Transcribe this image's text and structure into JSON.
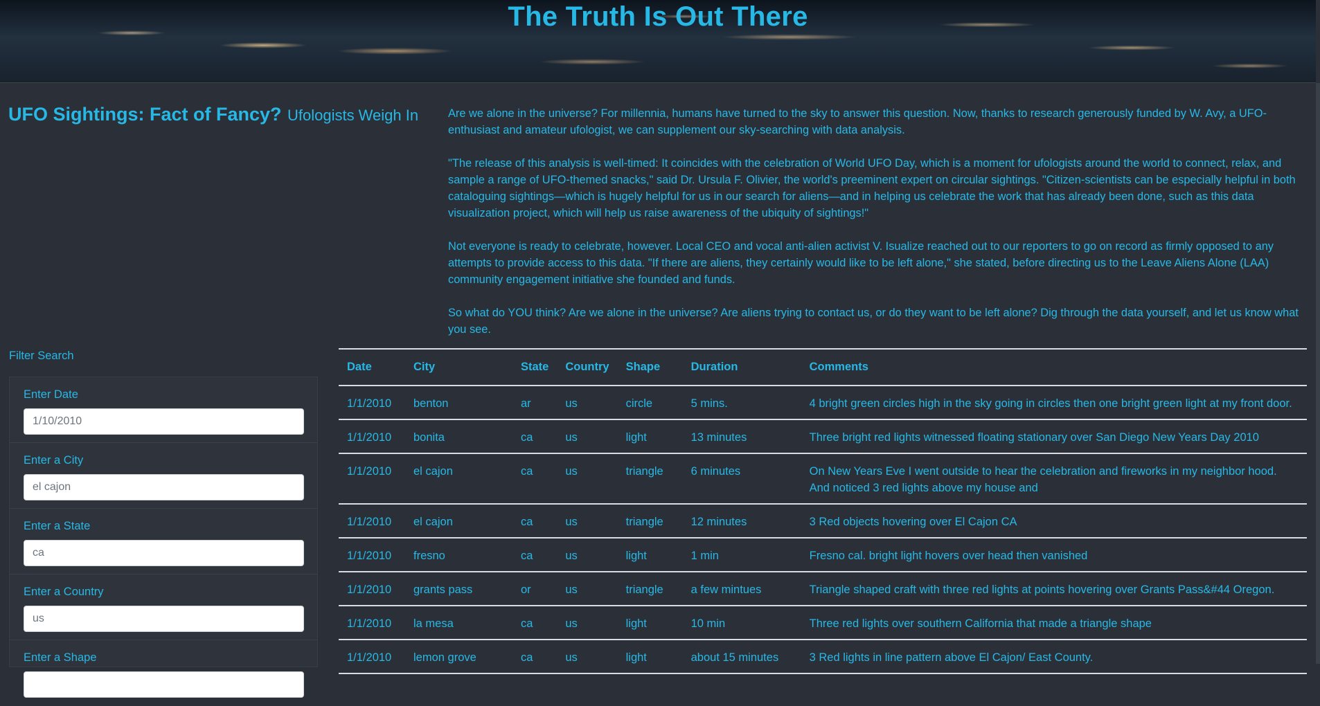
{
  "header": {
    "title": "The Truth Is Out There"
  },
  "intro": {
    "title": "UFO Sightings: Fact of Fancy?",
    "subtitle": "Ufologists Weigh In",
    "paragraphs": [
      "Are we alone in the universe? For millennia, humans have turned to the sky to answer this question. Now, thanks to research generously funded by W. Avy, a UFO-enthusiast and amateur ufologist, we can supplement our sky-searching with data analysis.",
      "\"The release of this analysis is well-timed: It coincides with the celebration of World UFO Day, which is a moment for ufologists around the world to connect, relax, and sample a range of UFO-themed snacks,\" said Dr. Ursula F. Olivier, the world's preeminent expert on circular sightings. \"Citizen-scientists can be especially helpful in both cataloguing sightings—which is hugely helpful for us in our search for aliens—and in helping us celebrate the work that has already been done, such as this data visualization project, which will help us raise awareness of the ubiquity of sightings!\"",
      "Not everyone is ready to celebrate, however. Local CEO and vocal anti-alien activist V. Isualize reached out to our reporters to go on record as firmly opposed to any attempts to provide access to this data. \"If there are aliens, they certainly would like to be left alone,\" she stated, before directing us to the Leave Aliens Alone (LAA) community engagement initiative she founded and funds.",
      "So what do YOU think? Are we alone in the universe? Are aliens trying to contact us, or do they want to be left alone? Dig through the data yourself, and let us know what you see."
    ]
  },
  "filters": {
    "heading": "Filter Search",
    "items": [
      {
        "label": "Enter Date",
        "placeholder": "1/10/2010"
      },
      {
        "label": "Enter a City",
        "placeholder": "el cajon"
      },
      {
        "label": "Enter a State",
        "placeholder": "ca"
      },
      {
        "label": "Enter a Country",
        "placeholder": "us"
      },
      {
        "label": "Enter a Shape",
        "placeholder": ""
      }
    ]
  },
  "table": {
    "columns": [
      "Date",
      "City",
      "State",
      "Country",
      "Shape",
      "Duration",
      "Comments"
    ],
    "rows": [
      [
        "1/1/2010",
        "benton",
        "ar",
        "us",
        "circle",
        "5 mins.",
        "4 bright green circles high in the sky going in circles then one bright green light at my front door."
      ],
      [
        "1/1/2010",
        "bonita",
        "ca",
        "us",
        "light",
        "13 minutes",
        "Three bright red lights witnessed floating stationary over San Diego New Years Day 2010"
      ],
      [
        "1/1/2010",
        "el cajon",
        "ca",
        "us",
        "triangle",
        "6 minutes",
        "On New Years Eve I went outside to hear the celebration and fireworks in my neighbor hood. And noticed 3 red lights above my house and"
      ],
      [
        "1/1/2010",
        "el cajon",
        "ca",
        "us",
        "triangle",
        "12 minutes",
        "3 Red objects hovering over El Cajon CA"
      ],
      [
        "1/1/2010",
        "fresno",
        "ca",
        "us",
        "light",
        "1 min",
        "Fresno cal. bright light hovers over head then vanished"
      ],
      [
        "1/1/2010",
        "grants pass",
        "or",
        "us",
        "triangle",
        "a few mintues",
        "Triangle shaped craft with three red lights at points hovering over Grants Pass&#44 Oregon."
      ],
      [
        "1/1/2010",
        "la mesa",
        "ca",
        "us",
        "light",
        "10 min",
        "Three red lights over southern California that made a triangle shape"
      ],
      [
        "1/1/2010",
        "lemon grove",
        "ca",
        "us",
        "light",
        "about 15 minutes",
        "3 Red lights in line pattern above El Cajon/ East County."
      ]
    ]
  }
}
